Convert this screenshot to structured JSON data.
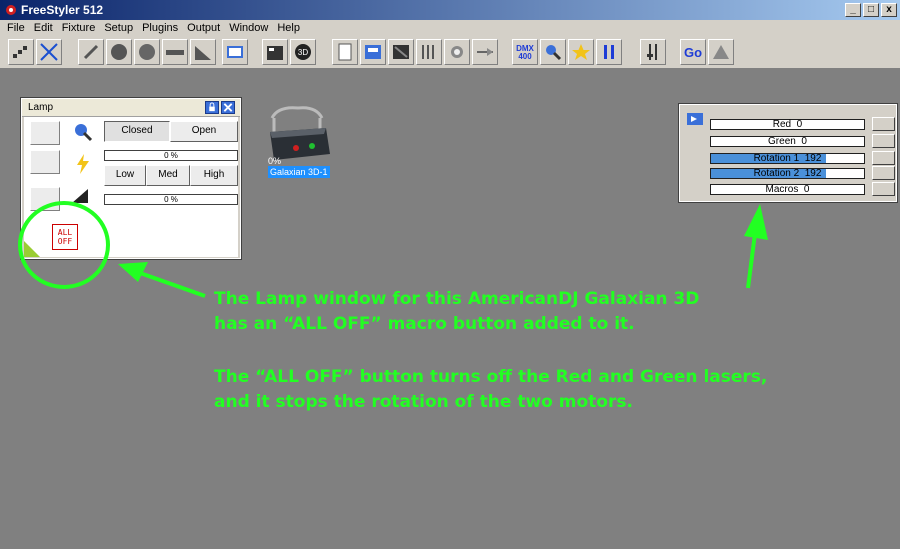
{
  "window": {
    "title": "FreeStyler 512",
    "buttons": [
      "_",
      "□",
      "x"
    ]
  },
  "menu": [
    "File",
    "Edit",
    "Fixture",
    "Setup",
    "Plugins",
    "Output",
    "Window",
    "Help"
  ],
  "toolbar": {
    "dmx_label": "DMX 400",
    "go_label": "Go"
  },
  "lamp_window": {
    "title": "Lamp",
    "shutter": {
      "closed_label": "Closed",
      "open_label": "Open"
    },
    "dimmer_percent": "0 %",
    "speed": {
      "low_label": "Low",
      "med_label": "Med",
      "high_label": "High"
    },
    "second_percent": "0 %",
    "alloff_line1": "ALL",
    "alloff_line2": "OFF"
  },
  "fixture": {
    "name": "Galaxian 3D-1",
    "percent": "0%"
  },
  "macro_panel": {
    "rows": [
      {
        "label": "Red",
        "value": "0",
        "fill": 0
      },
      {
        "label": "Green",
        "value": "0",
        "fill": 0
      },
      {
        "label": "Rotation 1",
        "value": "192",
        "fill": 0.75
      },
      {
        "label": "Rotation 2",
        "value": "192",
        "fill": 0.75
      },
      {
        "label": "Macros",
        "value": "0",
        "fill": 0
      }
    ]
  },
  "annotations": {
    "line1": "The Lamp window for this AmericanDJ Galaxian 3D",
    "line2": "has an “ALL OFF” macro button added to it.",
    "line3": "The “ALL OFF” button turns off the Red and Green lasers,",
    "line4": "and it stops the rotation of the two motors."
  },
  "colors": {
    "annotation": "#22ff22",
    "fixture_label_bg": "#1e90ff",
    "fill": "#4a90d9"
  }
}
